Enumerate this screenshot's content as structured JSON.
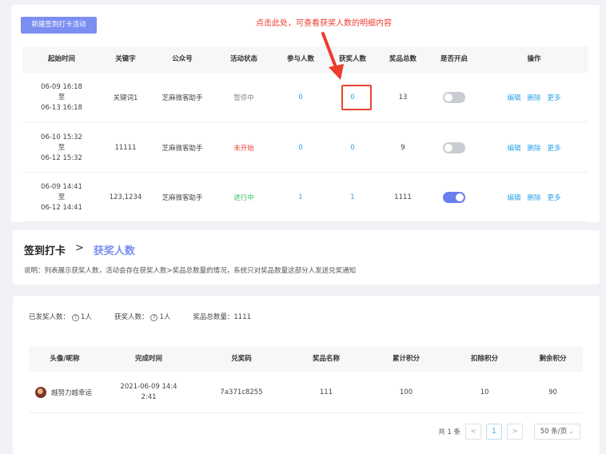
{
  "top": {
    "new_button": "新建签到打卡活动",
    "callout": "点击此处，可查看获奖人数的明细内容",
    "columns": [
      "起始时间",
      "关键字",
      "公众号",
      "活动状态",
      "参与人数",
      "获奖人数",
      "奖品总数",
      "是否开启",
      "操作"
    ],
    "rows": [
      {
        "start": "06-09 16:18",
        "to": "至",
        "end": "06-13 16:18",
        "keyword": "关键词1",
        "account": "芝麻微客助手",
        "status": "暂停中",
        "status_type": "paused",
        "participants": "0",
        "winners": "0",
        "prizes": "13",
        "enabled": false
      },
      {
        "start": "06-10 15:32",
        "to": "至",
        "end": "06-12 15:32",
        "keyword": "11111",
        "account": "芝麻微客助手",
        "status": "未开始",
        "status_type": "notstarted",
        "participants": "0",
        "winners": "0",
        "prizes": "9",
        "enabled": false
      },
      {
        "start": "06-09 14:41",
        "to": "至",
        "end": "06-12 14:41",
        "keyword": "123,1234",
        "account": "芝麻微客助手",
        "status": "进行中",
        "status_type": "running",
        "participants": "1",
        "winners": "1",
        "prizes": "1111",
        "enabled": true
      }
    ],
    "actions": {
      "edit": "编辑",
      "delete": "删除",
      "more": "更多"
    }
  },
  "detail": {
    "breadcrumb_root": "签到打卡",
    "breadcrumb_sep": ">",
    "breadcrumb_current": "获奖人数",
    "note": "说明：列表展示获奖人数，活动会存在获奖人数>奖品总数量的情况，系统只对奖品数量这部分人发送兑奖通知",
    "stats": {
      "sent_label": "已发奖人数：",
      "sent_value": "1人",
      "winners_label": "获奖人数：",
      "winners_value": "1人",
      "total_label": "奖品总数量：",
      "total_value": "1111"
    },
    "columns": [
      "头像/昵称",
      "完成时间",
      "兑奖码",
      "奖品名称",
      "累计积分",
      "扣除积分",
      "剩余积分"
    ],
    "row": {
      "nickname": "越努力越幸运",
      "time_line1": "2021-06-09 14:4",
      "time_line2": "2:41",
      "code": "7a371c8255",
      "prize": "111",
      "total_points": "100",
      "deducted": "10",
      "remaining": "90"
    },
    "pager": {
      "total": "共 1 条",
      "prev": "<",
      "page": "1",
      "next": ">",
      "size": "50 条/页"
    }
  },
  "colors": {
    "accent": "#7b8ef2",
    "link": "#2aa3e6",
    "callout": "#ee3c2f",
    "running": "#3cc05a",
    "notstarted": "#f0443a"
  }
}
